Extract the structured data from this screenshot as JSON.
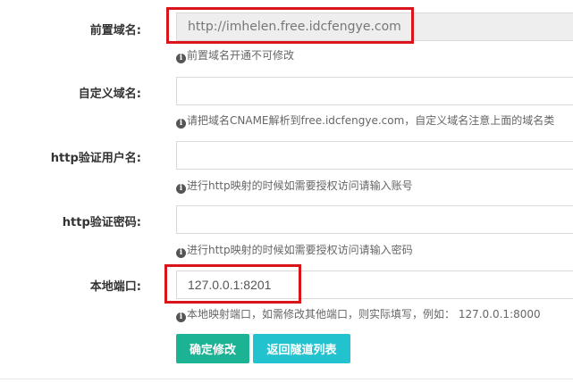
{
  "fields": [
    {
      "label": "前置域名:",
      "value": "http://imhelen.free.idcfengye.com",
      "placeholder": "",
      "readonly": true,
      "help": "前置域名开通不可修改"
    },
    {
      "label": "自定义域名:",
      "value": "",
      "placeholder": "",
      "readonly": false,
      "help": "请把域名CNAME解析到free.idcfengye.com，自定义域名注意上面的域名类"
    },
    {
      "label": "http验证用户名:",
      "value": "",
      "placeholder": "",
      "readonly": false,
      "help": "进行http映射的时候如需要授权访问请输入账号"
    },
    {
      "label": "http验证密码:",
      "value": "",
      "placeholder": "",
      "readonly": false,
      "help": "进行http映射的时候如需要授权访问请输入密码"
    },
    {
      "label": "本地端口:",
      "value": "127.0.0.1:8201",
      "placeholder": "",
      "readonly": false,
      "help": "本地映射端口，如需修改其他端口，则实际填写，例如： 127.0.0.1:8000"
    }
  ],
  "buttons": {
    "confirm_label": "确定修改",
    "back_label": "返回隧道列表"
  },
  "colors": {
    "highlight": "#d9141b",
    "confirm_button": "#1bb394",
    "back_button": "#22c3cf"
  }
}
